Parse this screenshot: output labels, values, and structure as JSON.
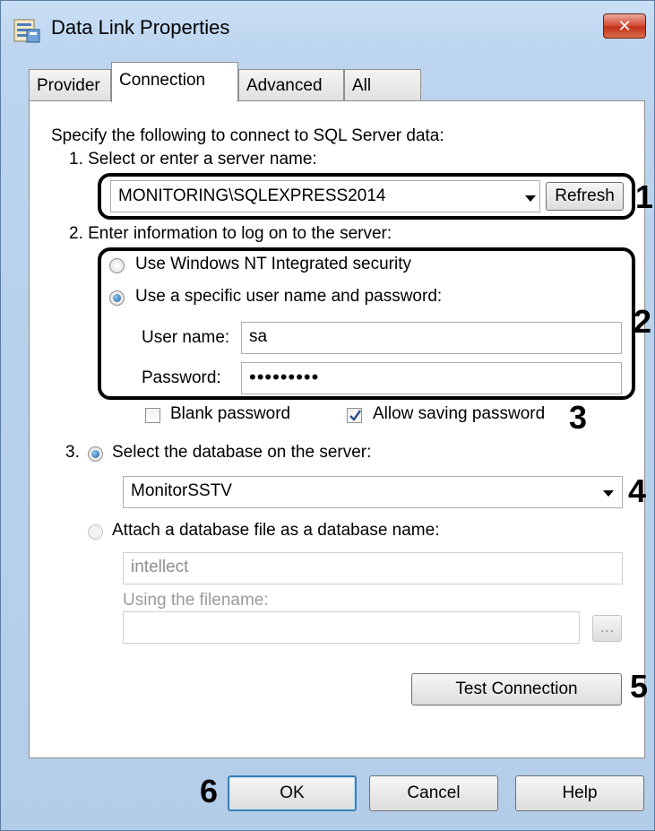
{
  "window": {
    "title": "Data Link Properties",
    "close_glyph": "✕"
  },
  "tabs": [
    {
      "label": "Provider"
    },
    {
      "label": "Connection"
    },
    {
      "label": "Advanced"
    },
    {
      "label": "All"
    }
  ],
  "connection": {
    "intro": "Specify the following to connect to SQL Server data:",
    "step1_label": "1. Select or enter a server name:",
    "server_name": "MONITORING\\SQLEXPRESS2014",
    "refresh_label": "Refresh",
    "step2_label": "2. Enter information to log on to the server:",
    "auth_windows_label": "Use Windows NT Integrated security",
    "auth_specific_label": "Use a specific user name and password:",
    "username_label": "User name:",
    "username_value": "sa",
    "password_label": "Password:",
    "password_value": "•••••••••",
    "blank_password_label": "Blank password",
    "blank_password_checked": false,
    "allow_saving_label": "Allow saving password",
    "allow_saving_checked": true,
    "step3_prefix": "3.",
    "select_db_label": "Select the database on the server:",
    "database_value": "MonitorSSTV",
    "attach_label": "Attach a database file as a database name:",
    "attach_db_name": "intellect",
    "using_filename_label": "Using the filename:",
    "filename_value": "",
    "browse_label": "...",
    "test_connection_label": "Test Connection"
  },
  "footer": {
    "ok_label": "OK",
    "cancel_label": "Cancel",
    "help_label": "Help"
  },
  "annotations": [
    "1",
    "2",
    "3",
    "4",
    "5",
    "6"
  ],
  "colors": {
    "annotation": "#000000",
    "accent_radio": "#1e5f9e",
    "close_button": "#c1331a"
  }
}
